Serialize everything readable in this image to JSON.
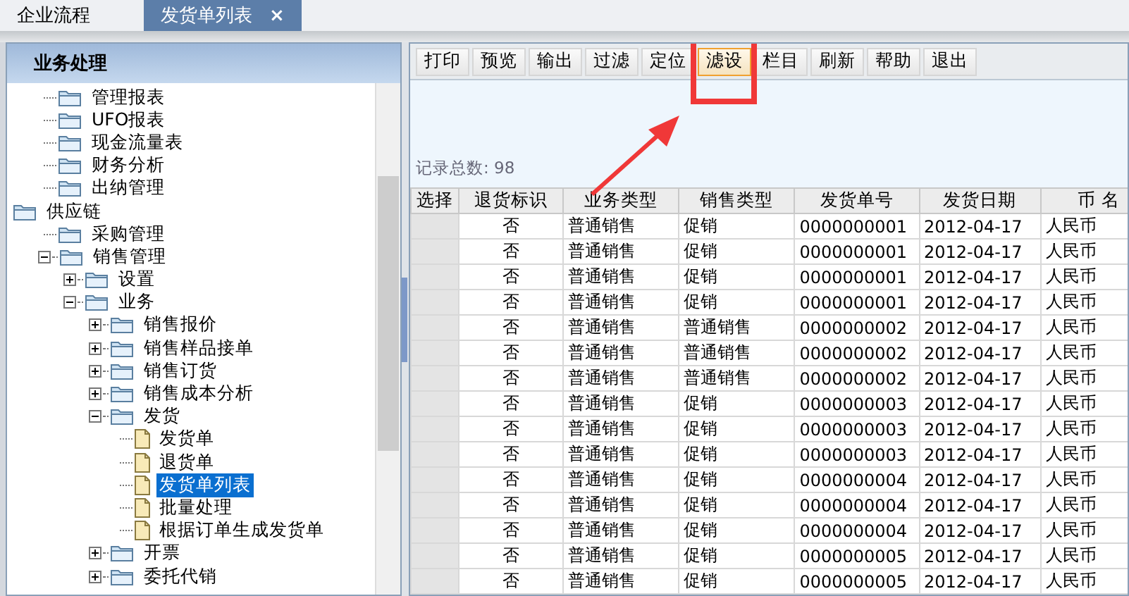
{
  "tabs": [
    {
      "label": "企业流程",
      "selected": false
    },
    {
      "label": "发货单列表",
      "selected": true,
      "close_glyph": "×"
    }
  ],
  "sidebar": {
    "title": "业务处理",
    "tree": {
      "continued_items": [
        {
          "label": "管理报表",
          "kind": "folder",
          "selected": false
        },
        {
          "label": "UFO报表",
          "kind": "folder",
          "selected": false
        },
        {
          "label": "现金流量表",
          "kind": "folder",
          "selected": false
        },
        {
          "label": "财务分析",
          "kind": "folder",
          "selected": false
        },
        {
          "label": "出纳管理",
          "kind": "folder",
          "selected": false
        }
      ],
      "items": [
        {
          "label": "供应链",
          "kind": "folder",
          "selected": false,
          "children": [
            {
              "label": "采购管理",
              "kind": "folder",
              "selected": false
            },
            {
              "label": "销售管理",
              "kind": "folder",
              "selected": false,
              "expanded": true,
              "children": [
                {
                  "label": "设置",
                  "kind": "folder",
                  "selected": false,
                  "expanded": false
                },
                {
                  "label": "业务",
                  "kind": "folder",
                  "selected": false,
                  "expanded": true,
                  "children": [
                    {
                      "label": "销售报价",
                      "kind": "folder",
                      "selected": false,
                      "expanded": false
                    },
                    {
                      "label": "销售样品接单",
                      "kind": "folder",
                      "selected": false,
                      "expanded": false
                    },
                    {
                      "label": "销售订货",
                      "kind": "folder",
                      "selected": false,
                      "expanded": false
                    },
                    {
                      "label": "销售成本分析",
                      "kind": "folder",
                      "selected": false,
                      "expanded": false
                    },
                    {
                      "label": "发货",
                      "kind": "folder",
                      "selected": false,
                      "expanded": true,
                      "children": [
                        {
                          "label": "发货单",
                          "kind": "document",
                          "selected": false
                        },
                        {
                          "label": "退货单",
                          "kind": "document",
                          "selected": false
                        },
                        {
                          "label": "发货单列表",
                          "kind": "document",
                          "selected": true
                        },
                        {
                          "label": "批量处理",
                          "kind": "document",
                          "selected": false
                        },
                        {
                          "label": "根据订单生成发货单",
                          "kind": "document",
                          "selected": false
                        }
                      ]
                    },
                    {
                      "label": "开票",
                      "kind": "folder",
                      "selected": false,
                      "expanded": false
                    },
                    {
                      "label": "委托代销",
                      "kind": "folder",
                      "selected": false,
                      "expanded": false
                    }
                  ]
                }
              ]
            }
          ]
        }
      ]
    }
  },
  "toolbar": [
    {
      "label": "打印",
      "selected": false
    },
    {
      "label": "预览",
      "selected": false
    },
    {
      "label": "输出",
      "selected": false
    },
    {
      "label": "过滤",
      "selected": false
    },
    {
      "label": "定位",
      "selected": false
    },
    {
      "label": "滤设",
      "selected": true
    },
    {
      "label": "栏目",
      "selected": false
    },
    {
      "label": "刷新",
      "selected": false
    },
    {
      "label": "帮助",
      "selected": false
    },
    {
      "label": "退出",
      "selected": false
    }
  ],
  "record_count": "记录总数: 98",
  "table": {
    "columns": [
      "选择",
      "退货标识",
      "业务类型",
      "销售类型",
      "发货单号",
      "发货日期",
      "币 名"
    ],
    "rows": [
      [
        "",
        "否",
        "普通销售",
        "促销",
        "0000000001",
        "2012-04-17",
        "人民币"
      ],
      [
        "",
        "否",
        "普通销售",
        "促销",
        "0000000001",
        "2012-04-17",
        "人民币"
      ],
      [
        "",
        "否",
        "普通销售",
        "促销",
        "0000000001",
        "2012-04-17",
        "人民币"
      ],
      [
        "",
        "否",
        "普通销售",
        "促销",
        "0000000001",
        "2012-04-17",
        "人民币"
      ],
      [
        "",
        "否",
        "普通销售",
        "普通销售",
        "0000000002",
        "2012-04-17",
        "人民币"
      ],
      [
        "",
        "否",
        "普通销售",
        "普通销售",
        "0000000002",
        "2012-04-17",
        "人民币"
      ],
      [
        "",
        "否",
        "普通销售",
        "普通销售",
        "0000000002",
        "2012-04-17",
        "人民币"
      ],
      [
        "",
        "否",
        "普通销售",
        "促销",
        "0000000003",
        "2012-04-17",
        "人民币"
      ],
      [
        "",
        "否",
        "普通销售",
        "促销",
        "0000000003",
        "2012-04-17",
        "人民币"
      ],
      [
        "",
        "否",
        "普通销售",
        "促销",
        "0000000003",
        "2012-04-17",
        "人民币"
      ],
      [
        "",
        "否",
        "普通销售",
        "促销",
        "0000000004",
        "2012-04-17",
        "人民币"
      ],
      [
        "",
        "否",
        "普通销售",
        "促销",
        "0000000004",
        "2012-04-17",
        "人民币"
      ],
      [
        "",
        "否",
        "普通销售",
        "促销",
        "0000000004",
        "2012-04-17",
        "人民币"
      ],
      [
        "",
        "否",
        "普通销售",
        "促销",
        "0000000005",
        "2012-04-17",
        "人民币"
      ],
      [
        "",
        "否",
        "普通销售",
        "促销",
        "0000000005",
        "2012-04-17",
        "人民币"
      ]
    ]
  }
}
